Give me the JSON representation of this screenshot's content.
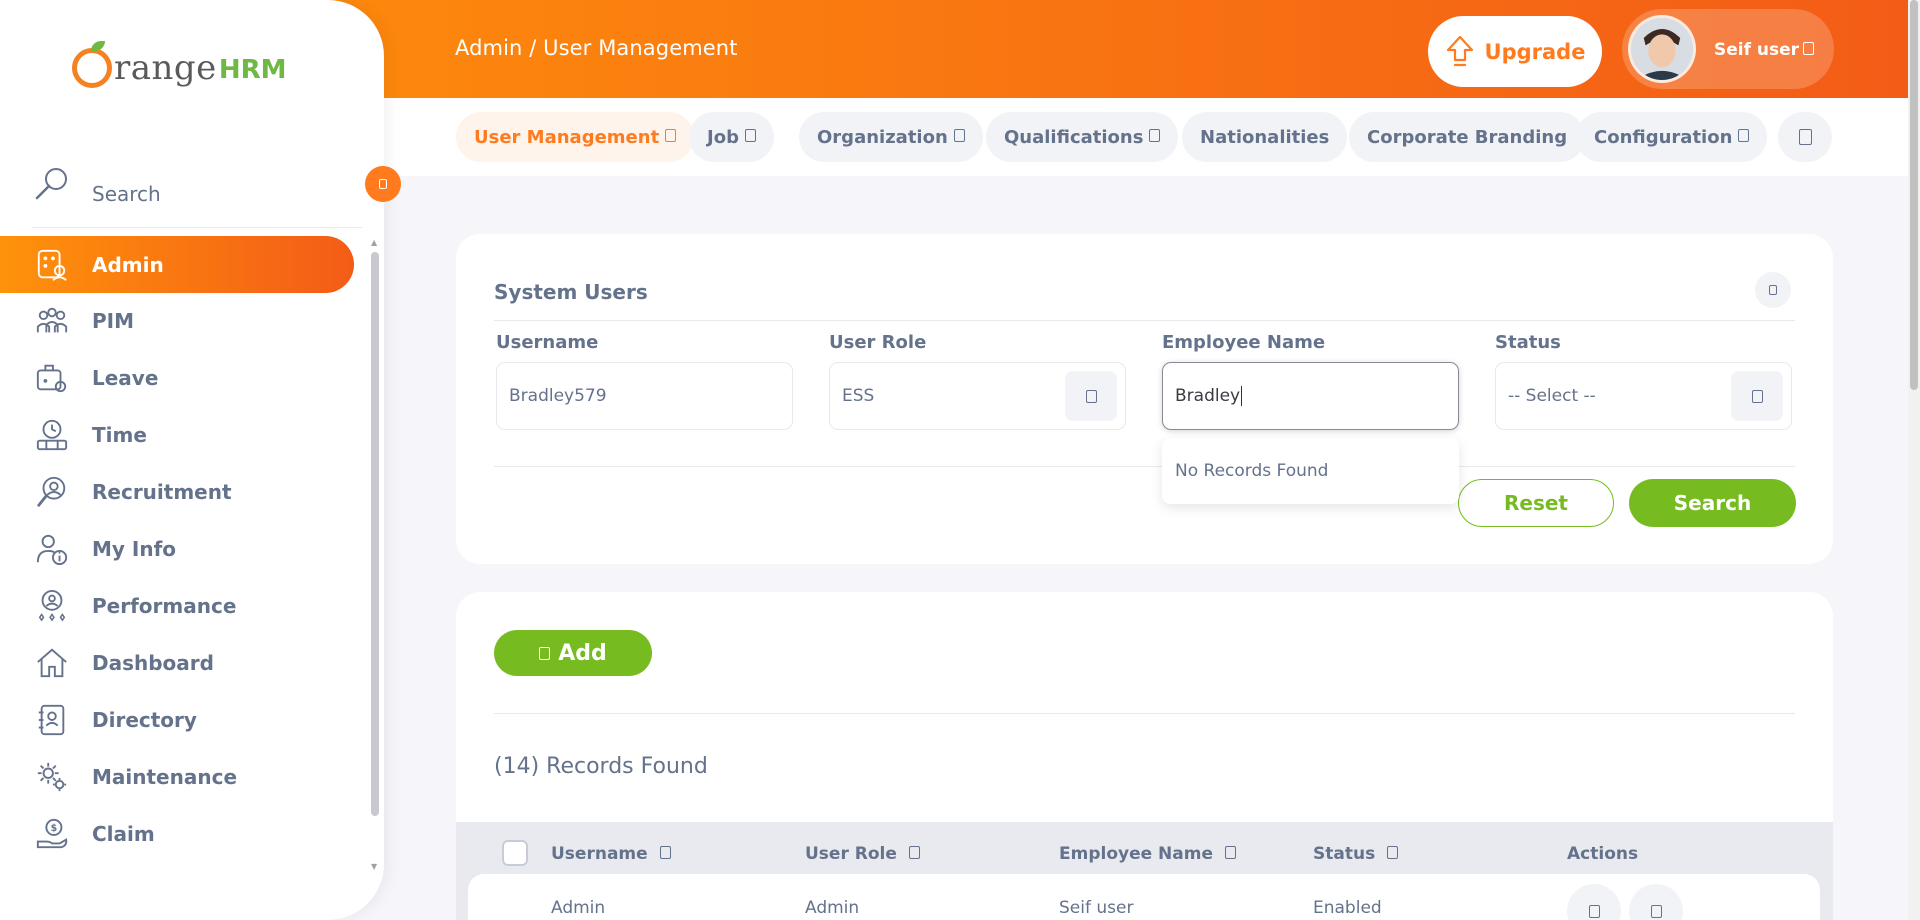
{
  "header": {
    "breadcrumb": "Admin / User Management",
    "upgrade_label": "Upgrade",
    "user_name": "Seif user"
  },
  "sidebar": {
    "brand_word": "range",
    "brand_suffix": "HRM",
    "search_label": "Search",
    "items": [
      {
        "label": "Admin",
        "icon": "admin-icon"
      },
      {
        "label": "PIM",
        "icon": "pim-icon"
      },
      {
        "label": "Leave",
        "icon": "leave-icon"
      },
      {
        "label": "Time",
        "icon": "time-icon"
      },
      {
        "label": "Recruitment",
        "icon": "recruitment-icon"
      },
      {
        "label": "My Info",
        "icon": "my-info-icon"
      },
      {
        "label": "Performance",
        "icon": "performance-icon"
      },
      {
        "label": "Dashboard",
        "icon": "dashboard-icon"
      },
      {
        "label": "Directory",
        "icon": "directory-icon"
      },
      {
        "label": "Maintenance",
        "icon": "maintenance-icon"
      },
      {
        "label": "Claim",
        "icon": "claim-icon"
      }
    ]
  },
  "subnav": {
    "tabs": [
      {
        "label": "User Management"
      },
      {
        "label": "Job"
      },
      {
        "label": "Organization"
      },
      {
        "label": "Qualifications"
      },
      {
        "label": "Nationalities"
      },
      {
        "label": "Corporate Branding"
      },
      {
        "label": "Configuration"
      }
    ]
  },
  "filter": {
    "title": "System Users",
    "username_label": "Username",
    "username_value": "Bradley579",
    "role_label": "User Role",
    "role_value": "ESS",
    "employee_label": "Employee Name",
    "employee_value": "Bradley",
    "status_label": "Status",
    "status_value": "-- Select --",
    "dropdown_message": "No Records Found",
    "reset_label": "Reset",
    "search_label": "Search"
  },
  "list": {
    "add_label": "Add",
    "records_found": "(14) Records Found",
    "columns": [
      "Username",
      "User Role",
      "Employee Name",
      "Status",
      "Actions"
    ],
    "rows": [
      {
        "username": "Admin",
        "role": "Admin",
        "employee": "Seif user",
        "status": "Enabled"
      }
    ]
  },
  "colors": {
    "brand_orange": "#ff7b1d",
    "brand_green": "#76bc21",
    "text": "#64728c"
  }
}
